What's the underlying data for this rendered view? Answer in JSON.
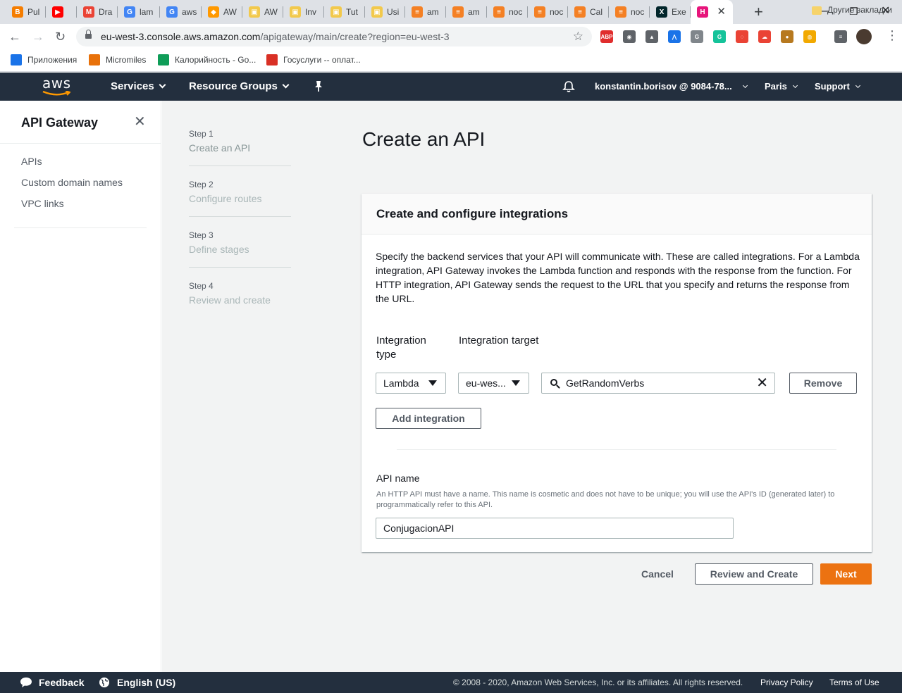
{
  "browser": {
    "tabs": [
      {
        "title": "Pul",
        "icon": "blogger-icon",
        "color": "#f57d00",
        "glyph": "B"
      },
      {
        "title": "",
        "icon": "youtube-icon",
        "color": "#ff0000",
        "glyph": "▶"
      },
      {
        "title": "Dra",
        "icon": "gmail-icon",
        "color": "#ea4335",
        "glyph": "M"
      },
      {
        "title": "lam",
        "icon": "google-icon",
        "color": "#4285f4",
        "glyph": "G"
      },
      {
        "title": "aws",
        "icon": "google-icon",
        "color": "#4285f4",
        "glyph": "G"
      },
      {
        "title": "AW",
        "icon": "aws-cube-icon",
        "color": "#f90",
        "glyph": "◆"
      },
      {
        "title": "AW",
        "icon": "aws-box-icon",
        "color": "#f2c94c",
        "glyph": "▣"
      },
      {
        "title": "Inv",
        "icon": "aws-box-icon",
        "color": "#f2c94c",
        "glyph": "▣"
      },
      {
        "title": "Tut",
        "icon": "aws-box-icon",
        "color": "#f2c94c",
        "glyph": "▣"
      },
      {
        "title": "Usi",
        "icon": "aws-box-icon",
        "color": "#f2c94c",
        "glyph": "▣"
      },
      {
        "title": "am",
        "icon": "stackoverflow-icon",
        "color": "#f48024",
        "glyph": "≡"
      },
      {
        "title": "am",
        "icon": "stackoverflow-icon",
        "color": "#f48024",
        "glyph": "≡"
      },
      {
        "title": "noc",
        "icon": "stackoverflow-icon",
        "color": "#f48024",
        "glyph": "≡"
      },
      {
        "title": "noc",
        "icon": "stackoverflow-icon",
        "color": "#f48024",
        "glyph": "≡"
      },
      {
        "title": "Cal",
        "icon": "stackoverflow-icon",
        "color": "#f48024",
        "glyph": "≡"
      },
      {
        "title": "noc",
        "icon": "stackoverflow-icon",
        "color": "#f48024",
        "glyph": "≡"
      },
      {
        "title": "Exe",
        "icon": "edx-icon",
        "color": "#02262b",
        "glyph": "X"
      },
      {
        "title": "",
        "icon": "api-gateway-icon",
        "color": "#e7157b",
        "glyph": "H",
        "active": true
      }
    ],
    "url_host": "eu-west-3.console.aws.amazon.com",
    "url_path": "/apigateway/main/create?region=eu-west-3",
    "extensions": [
      {
        "name": "adblock-icon",
        "color": "#e02d2d",
        "glyph": "ABP"
      },
      {
        "name": "reel-icon",
        "color": "#5f6368",
        "glyph": "◉"
      },
      {
        "name": "drive-icon",
        "color": "#5f6368",
        "glyph": "▲"
      },
      {
        "name": "acrobat-icon",
        "color": "#1a73e8",
        "glyph": "⋀"
      },
      {
        "name": "g-extension-icon",
        "color": "#80868b",
        "glyph": "G"
      },
      {
        "name": "grammarly-icon",
        "color": "#15c39a",
        "glyph": "G"
      },
      {
        "name": "vpn-icon",
        "color": "#ea4335",
        "glyph": "◌"
      },
      {
        "name": "cloud-icon",
        "color": "#ea4335",
        "glyph": "☁"
      },
      {
        "name": "cookie-icon",
        "color": "#b7791f",
        "glyph": "●"
      },
      {
        "name": "search-ext-icon",
        "color": "#f2a900",
        "glyph": "◍"
      },
      {
        "name": "playlist-icon",
        "color": "#5f6368",
        "glyph": "≡"
      }
    ],
    "bookmarks": [
      {
        "label": "Приложения",
        "icon": "apps-grid-icon",
        "color": "#1a73e8"
      },
      {
        "label": "Micromiles",
        "icon": "micromiles-icon",
        "color": "#e8710a"
      },
      {
        "label": "Калорийность - Go...",
        "icon": "sheets-icon",
        "color": "#0f9d58"
      },
      {
        "label": "Госуслуги -- оплат...",
        "icon": "gosuslugi-icon",
        "color": "#d93025"
      }
    ],
    "other_bookmarks": "Другие закладки"
  },
  "aws_header": {
    "logo": "aws",
    "services": "Services",
    "resource_groups": "Resource Groups",
    "account": "konstantin.borisov @ 9084-78...",
    "region": "Paris",
    "support": "Support"
  },
  "sidebar": {
    "title": "API Gateway",
    "items": [
      "APIs",
      "Custom domain names",
      "VPC links"
    ]
  },
  "steps": [
    {
      "num": "Step 1",
      "name": "Create an API"
    },
    {
      "num": "Step 2",
      "name": "Configure routes"
    },
    {
      "num": "Step 3",
      "name": "Define stages"
    },
    {
      "num": "Step 4",
      "name": "Review and create"
    }
  ],
  "page": {
    "title": "Create an API",
    "panel_title": "Create and configure integrations",
    "description": "Specify the backend services that your API will communicate with. These are called integrations. For a Lambda integration, API Gateway invokes the Lambda function and responds with the response from the function. For HTTP integration, API Gateway sends the request to the URL that you specify and returns the response from the URL.",
    "integration_type_label": "Integration type",
    "integration_target_label": "Integration target",
    "integration_type_value": "Lambda",
    "region_value": "eu-wes...",
    "target_value": "GetRandomVerbs",
    "remove_label": "Remove",
    "add_integration_label": "Add integration",
    "api_name_label": "API name",
    "api_name_help": "An HTTP API must have a name. This name is cosmetic and does not have to be unique; you will use the API's ID (generated later) to programmatically refer to this API.",
    "api_name_value": "ConjugacionAPI"
  },
  "actions": {
    "cancel": "Cancel",
    "review": "Review and Create",
    "next": "Next"
  },
  "footer": {
    "feedback": "Feedback",
    "language": "English (US)",
    "copyright": "© 2008 - 2020, Amazon Web Services, Inc. or its affiliates. All rights reserved.",
    "privacy": "Privacy Policy",
    "terms": "Terms of Use"
  },
  "colors": {
    "aws_nav": "#232f3e",
    "primary_button": "#ec7211",
    "active_tab_icon": "#e7157b"
  }
}
